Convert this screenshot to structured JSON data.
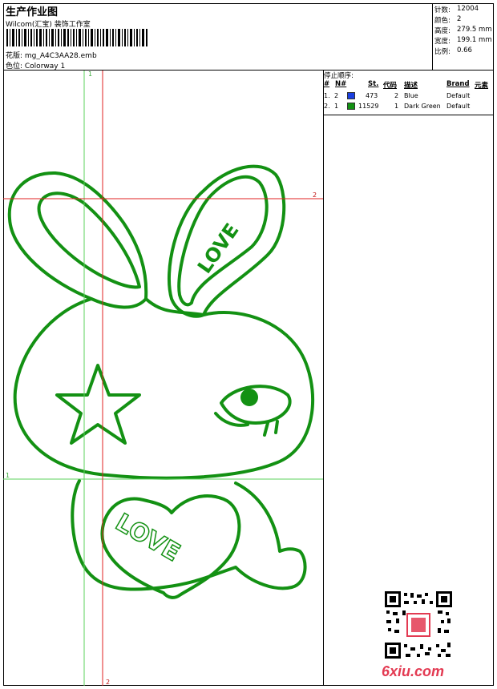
{
  "header": {
    "title": "生产作业图",
    "subtitle": "Wilcom(汇宝) 装饰工作室",
    "design_label": "花版: mg_A4C3AA28.emb",
    "colorway_label": "色位: Colorway 1"
  },
  "stats": [
    {
      "label": "针数:",
      "value": "12004"
    },
    {
      "label": "颜色:",
      "value": "2"
    },
    {
      "label": "高度:",
      "value": "279.5 mm"
    },
    {
      "label": "宽度:",
      "value": "199.1 mm"
    },
    {
      "label": "比例:",
      "value": "0.66"
    }
  ],
  "guides": {
    "green_v_label": "1",
    "green_h_label": "1",
    "red_h_label": "2",
    "red_v_label": "2"
  },
  "design_text": {
    "ear_word": "LOVE",
    "heart_word": "LOVE"
  },
  "sequence": {
    "caption": "停止顺序:",
    "headers": [
      "#",
      "N#",
      "St.",
      "代码",
      "描述",
      "Brand",
      "元素"
    ],
    "rows": [
      {
        "idx": "1.",
        "n": "2",
        "color": "#1a3fe0",
        "stitches": "473",
        "code": "2",
        "desc": "Blue",
        "brand": "Default"
      },
      {
        "idx": "2.",
        "n": "1",
        "color": "#139113",
        "stitches": "11529",
        "code": "1",
        "desc": "Dark Green",
        "brand": "Default"
      }
    ]
  },
  "colors": {
    "thread": "#139113",
    "guide_green": "#5ed35e",
    "guide_red": "#e02020"
  },
  "watermark": {
    "text": "6xiu.com"
  }
}
